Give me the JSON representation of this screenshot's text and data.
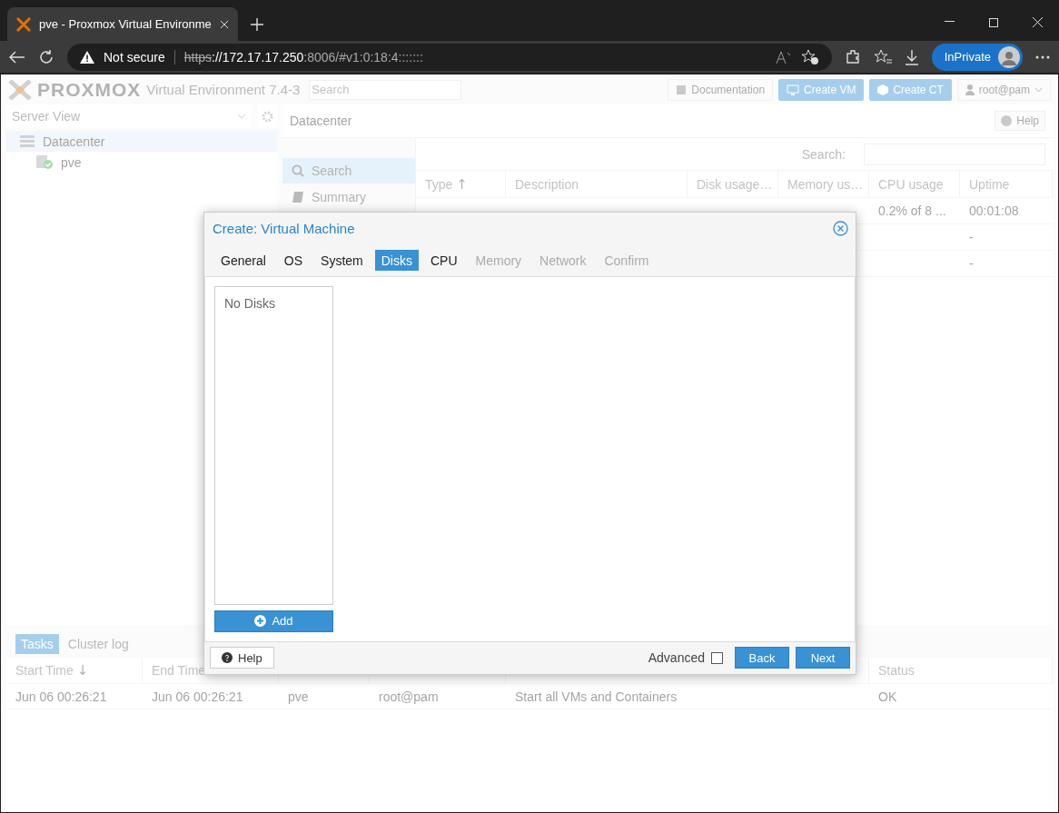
{
  "browser": {
    "tab_title": "pve - Proxmox Virtual Environme",
    "security": "Not secure",
    "url": {
      "scheme": "https",
      "host": "://172.17.17.250",
      "rest": ":8006/#v1:0:18:4:::::::"
    },
    "profile": "InPrivate"
  },
  "header": {
    "logo_text": "PROXMOX",
    "version": "Virtual Environment 7.4-3",
    "search": {
      "placeholder": "Search"
    },
    "buttons": [
      {
        "label": "Documentation",
        "kind": "plain"
      },
      {
        "label": "Create VM",
        "kind": "primary"
      },
      {
        "label": "Create CT",
        "kind": "primary"
      },
      {
        "label": "root@pam",
        "kind": "user"
      }
    ]
  },
  "tree": {
    "view": "Server View",
    "items": [
      {
        "label": "Datacenter",
        "selected": true,
        "children": [
          {
            "label": "pve",
            "selected": false
          }
        ]
      }
    ]
  },
  "content": {
    "title": "Datacenter",
    "help": "Help",
    "nav": [
      {
        "label": "Search",
        "selected": true
      },
      {
        "label": "Summary",
        "selected": false
      }
    ],
    "search_label": "Search:",
    "columns": [
      {
        "label": "Type",
        "sort_icon": "↑"
      },
      {
        "label": "Description"
      },
      {
        "label": "Disk usage…"
      },
      {
        "label": "Memory us…"
      },
      {
        "label": "CPU usage"
      },
      {
        "label": "Uptime"
      }
    ],
    "rows": [
      {
        "cells": [
          null,
          null,
          null,
          null,
          "0.2% of 8 ...",
          "00:01:08"
        ]
      },
      {
        "cells": [
          null,
          null,
          null,
          null,
          null,
          "-"
        ]
      },
      {
        "cells": [
          null,
          null,
          null,
          null,
          null,
          "-"
        ]
      }
    ]
  },
  "tasks": {
    "tabs": [
      {
        "label": "Tasks",
        "selected": true
      },
      {
        "label": "Cluster log",
        "selected": false
      }
    ],
    "columns": [
      {
        "label": "Start Time",
        "sort_icon": "↓"
      },
      {
        "label": "End Time"
      },
      {},
      {},
      {},
      {
        "label": "Status"
      }
    ],
    "rows": [
      [
        "Jun 06 00:26:21",
        "Jun 06 00:26:21",
        "pve",
        "root@pam",
        "Start all VMs and Containers",
        "OK"
      ]
    ]
  },
  "dialog": {
    "title": "Create: Virtual Machine",
    "tabs": [
      {
        "label": "General",
        "selected": false,
        "disabled": false
      },
      {
        "label": "OS",
        "selected": false,
        "disabled": false
      },
      {
        "label": "System",
        "selected": false,
        "disabled": false
      },
      {
        "label": "Disks",
        "selected": true,
        "disabled": false
      },
      {
        "label": "CPU",
        "selected": false,
        "disabled": false
      },
      {
        "label": "Memory",
        "selected": false,
        "disabled": true
      },
      {
        "label": "Network",
        "selected": false,
        "disabled": true
      },
      {
        "label": "Confirm",
        "selected": false,
        "disabled": true
      }
    ],
    "disk_list": {
      "empty_text": "No Disks"
    },
    "add": "Add",
    "help": "Help",
    "advanced": {
      "label": "Advanced",
      "checked": false
    },
    "back": "Back",
    "next": "Next"
  }
}
